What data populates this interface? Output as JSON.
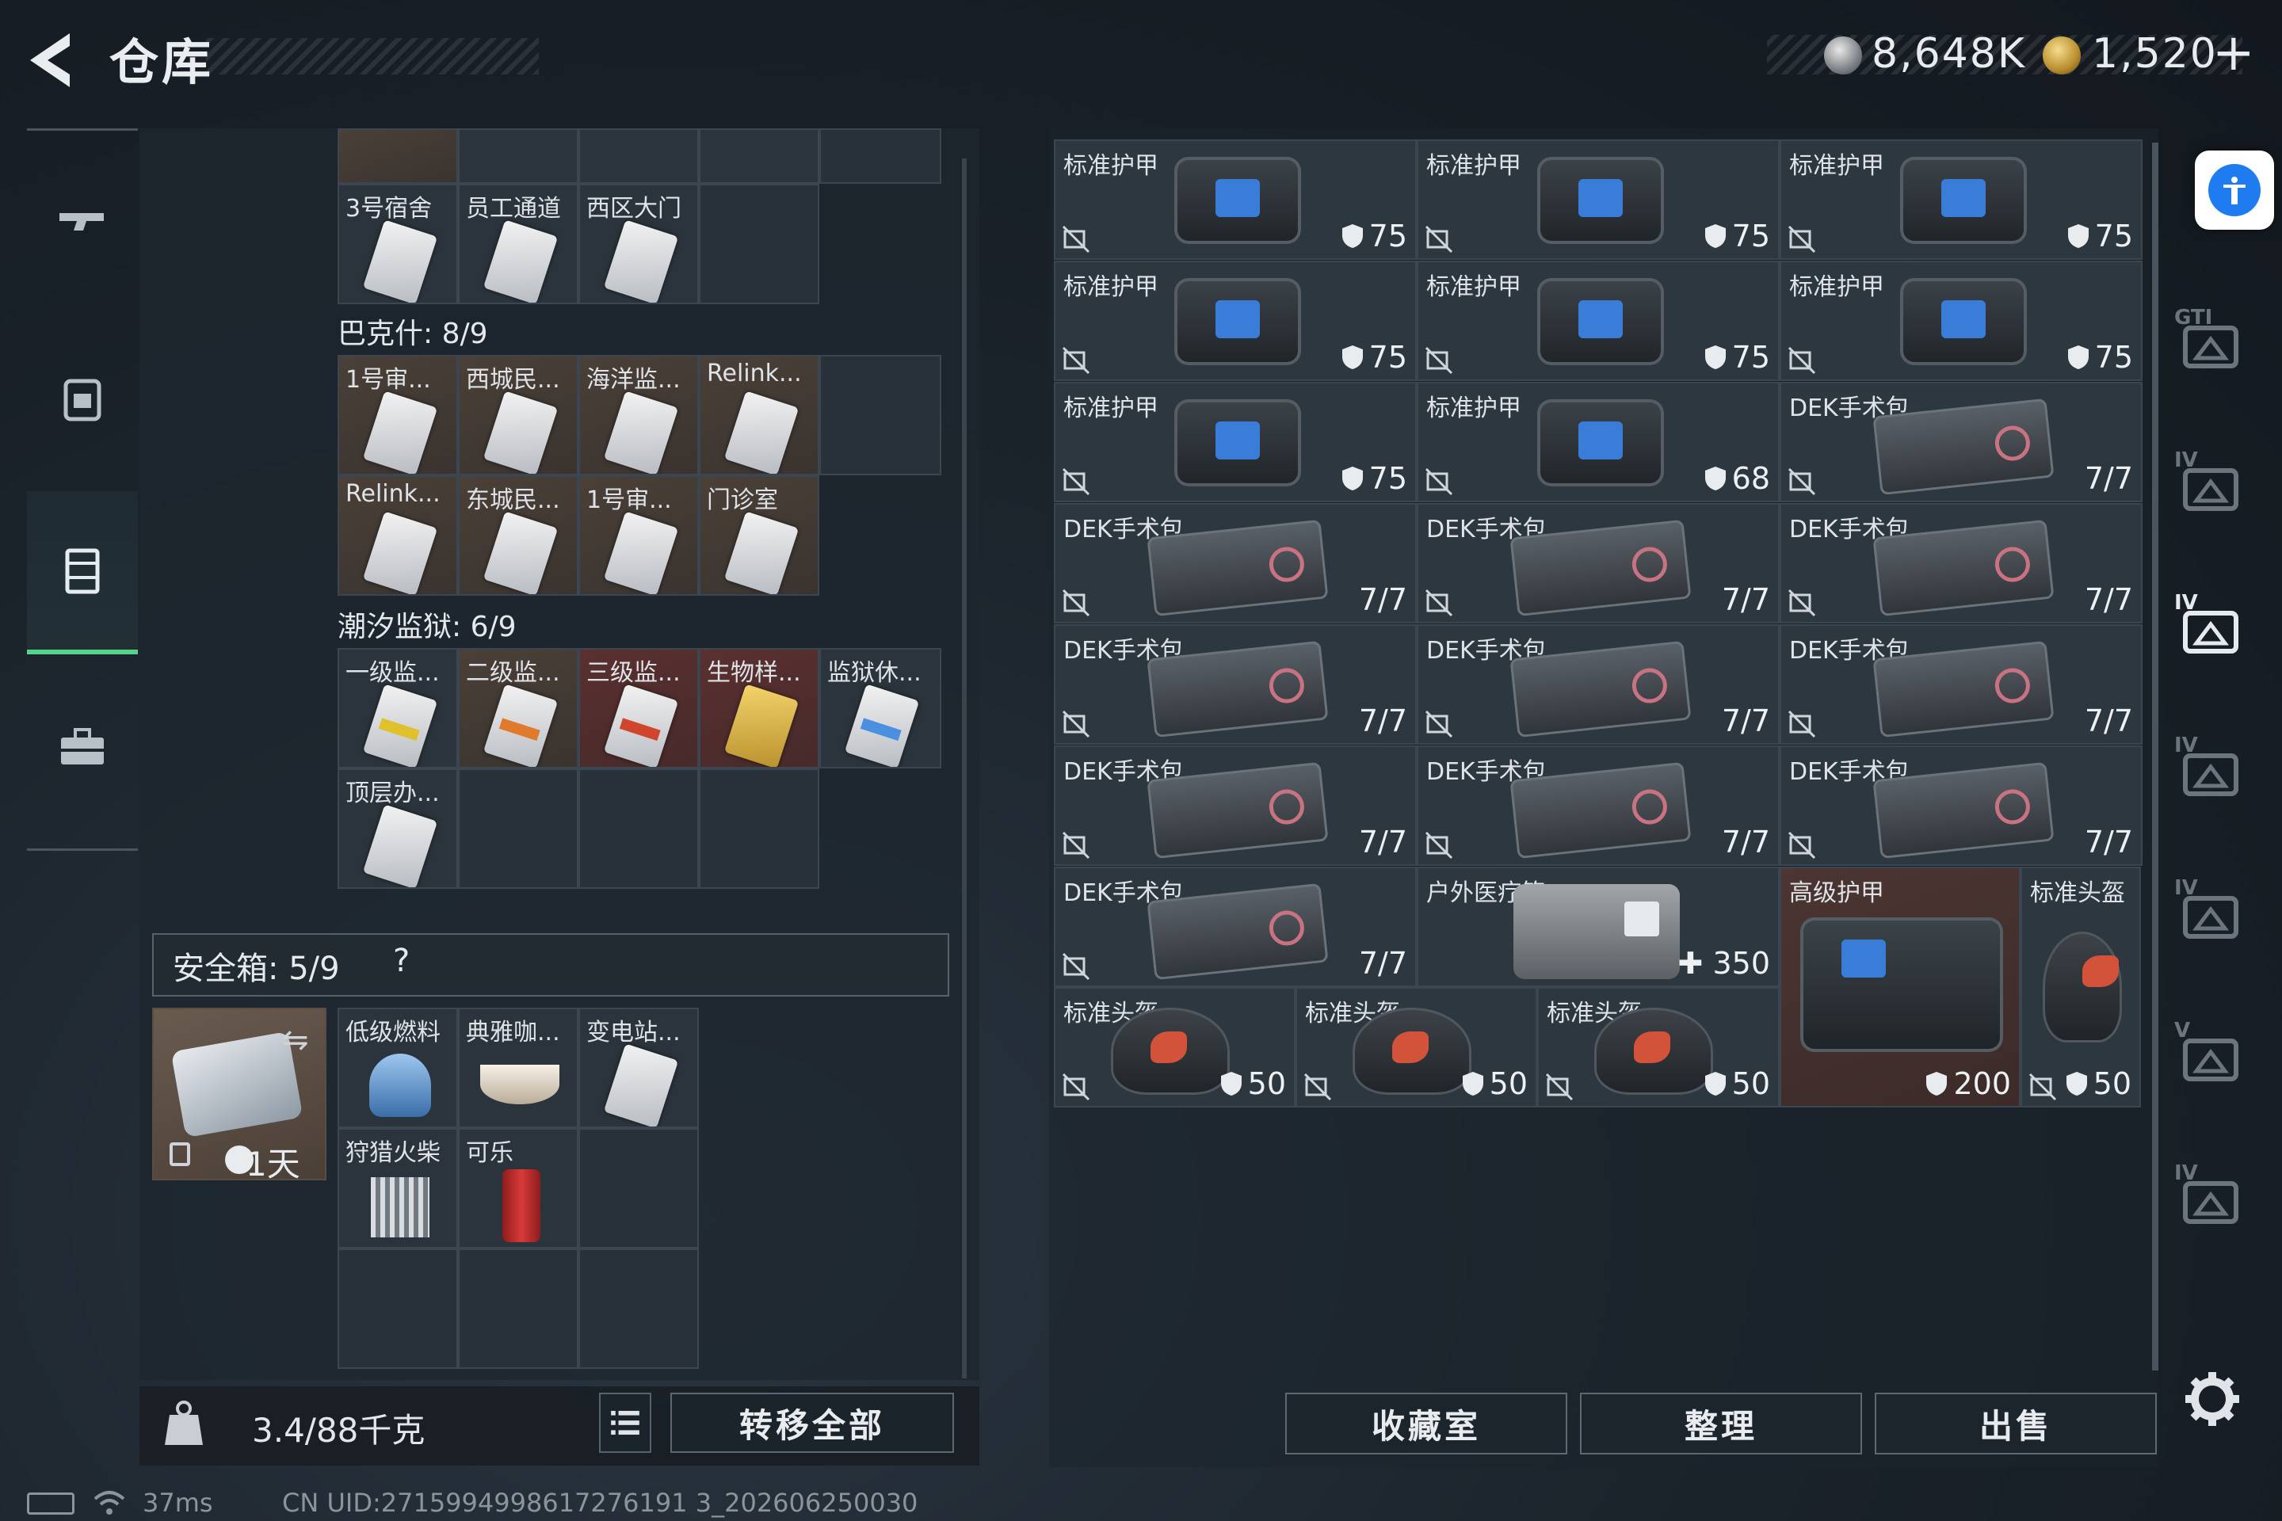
{
  "header": {
    "title": "仓库",
    "currency1": "8,648K",
    "currency2": "1,520",
    "currency2_plus": "+"
  },
  "left": {
    "row0_cells": [
      {
        "label": ""
      },
      {
        "label": ""
      },
      {
        "label": ""
      },
      {
        "label": ""
      }
    ],
    "row1_cells": [
      {
        "label": "3号宿舍"
      },
      {
        "label": "员工通道"
      },
      {
        "label": "西区大门"
      },
      {
        "label": ""
      }
    ],
    "bakesh_title": "巴克什: 8/9",
    "bakesh_cells": [
      {
        "label": "1号审..."
      },
      {
        "label": "西城民..."
      },
      {
        "label": "海洋监..."
      },
      {
        "label": "Relink..."
      },
      {
        "label": ""
      },
      {
        "label": "Relink..."
      },
      {
        "label": "东城民..."
      },
      {
        "label": "1号审..."
      },
      {
        "label": "门诊室"
      }
    ],
    "prison_title": "潮汐监狱: 6/9",
    "prison_cells": [
      {
        "label": "一级监..."
      },
      {
        "label": "二级监..."
      },
      {
        "label": "三级监..."
      },
      {
        "label": "生物样..."
      },
      {
        "label": "监狱休..."
      },
      {
        "label": "顶层办..."
      },
      {
        "label": ""
      },
      {
        "label": ""
      },
      {
        "label": ""
      }
    ],
    "safebox_title": "安全箱: 5/9",
    "safebox_help": "?",
    "safe_time": "1天",
    "safe_cells": [
      {
        "label": "低级燃料"
      },
      {
        "label": "典雅咖..."
      },
      {
        "label": "变电站..."
      },
      {
        "label": "狩猎火柴"
      },
      {
        "label": "可乐"
      },
      {
        "label": ""
      },
      {
        "label": ""
      },
      {
        "label": ""
      },
      {
        "label": ""
      }
    ],
    "weight": "3.4/88千克",
    "transfer_label": "转移全部"
  },
  "right": {
    "grid": [
      [
        {
          "label": "标准护甲",
          "value": "75"
        },
        {
          "label": "标准护甲",
          "value": "75"
        },
        {
          "label": "标准护甲",
          "value": "75"
        }
      ],
      [
        {
          "label": "标准护甲",
          "value": "75"
        },
        {
          "label": "标准护甲",
          "value": "75"
        },
        {
          "label": "标准护甲",
          "value": "75"
        }
      ],
      [
        {
          "label": "标准护甲",
          "value": "75"
        },
        {
          "label": "标准护甲",
          "value": "68"
        },
        {
          "label": "DEK手术包",
          "value": "7/7"
        }
      ],
      [
        {
          "label": "DEK手术包",
          "value": "7/7"
        },
        {
          "label": "DEK手术包",
          "value": "7/7"
        },
        {
          "label": "DEK手术包",
          "value": "7/7"
        }
      ],
      [
        {
          "label": "DEK手术包",
          "value": "7/7"
        },
        {
          "label": "DEK手术包",
          "value": "7/7"
        },
        {
          "label": "DEK手术包",
          "value": "7/7"
        }
      ],
      [
        {
          "label": "DEK手术包",
          "value": "7/7"
        },
        {
          "label": "DEK手术包",
          "value": "7/7"
        },
        {
          "label": "DEK手术包",
          "value": "7/7"
        }
      ]
    ],
    "row6": [
      {
        "label": "DEK手术包",
        "value": "7/7"
      },
      {
        "label": "户外医疗箱",
        "value": "350",
        "prefix": "✚"
      }
    ],
    "large_armor": {
      "label": "高级护甲",
      "value": "200"
    },
    "helmet_tall": {
      "label": "标准头盔",
      "value": "50"
    },
    "helmets_row": [
      {
        "label": "标准头盔",
        "value": "50"
      },
      {
        "label": "标准头盔",
        "value": "50"
      },
      {
        "label": "标准头盔",
        "value": "50"
      }
    ],
    "buttons": {
      "collect": "收藏室",
      "sort": "整理",
      "sell": "出售"
    },
    "rail_labels": [
      "GTI",
      "IV",
      "IV",
      "IV",
      "IV",
      "V",
      "IV"
    ]
  },
  "status": {
    "ping": "37ms",
    "uid": "CN UID:2715994998617276191 3_202606250030"
  },
  "colors": {
    "accent_green": "#56d38a",
    "access_blue": "#1f7cf0"
  }
}
